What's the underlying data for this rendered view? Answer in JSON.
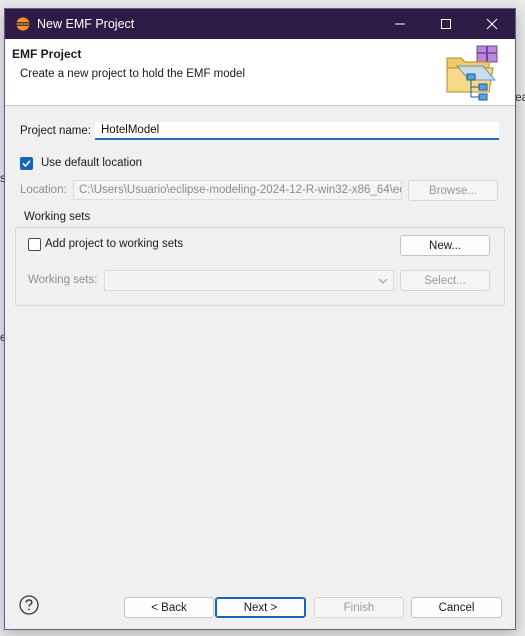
{
  "window": {
    "title": "New EMF Project"
  },
  "header": {
    "title": "EMF Project",
    "description": "Create a new project to hold the EMF model"
  },
  "form": {
    "project_name_label": "Project name:",
    "project_name_value": "HotelModel",
    "use_default_location_label": "Use default location",
    "use_default_location_checked": true,
    "location_label": "Location:",
    "location_value": "C:\\Users\\Usuario\\eclipse-modeling-2024-12-R-win32-x86_64\\ec",
    "browse_label": "Browse..."
  },
  "working_sets": {
    "group_label": "Working sets",
    "add_label": "Add project to working sets",
    "add_checked": false,
    "new_label": "New...",
    "working_sets_label": "Working sets:",
    "working_sets_value": "",
    "select_label": "Select..."
  },
  "footer": {
    "back_label": "< Back",
    "next_label": "Next >",
    "finish_label": "Finish",
    "cancel_label": "Cancel"
  },
  "background": {
    "fragment_top": "ea",
    "fragment_left_1": "s",
    "fragment_left_2": "e"
  },
  "colors": {
    "titlebar": "#2e1c47",
    "accent": "#1a64b8"
  },
  "icons": {
    "app": "eclipse-icon",
    "minimize": "minimize-icon",
    "maximize": "maximize-icon",
    "close": "close-icon",
    "wizard": "project-folder-icon",
    "help": "help-icon",
    "combo": "chevron-down-icon"
  }
}
